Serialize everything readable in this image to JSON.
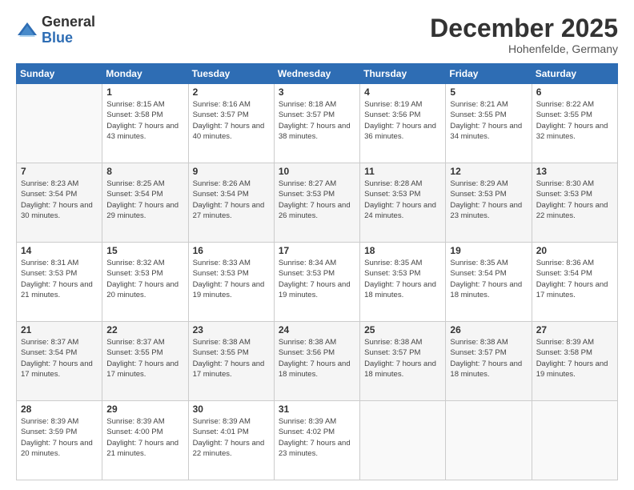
{
  "logo": {
    "general": "General",
    "blue": "Blue"
  },
  "title": "December 2025",
  "location": "Hohenfelde, Germany",
  "days_of_week": [
    "Sunday",
    "Monday",
    "Tuesday",
    "Wednesday",
    "Thursday",
    "Friday",
    "Saturday"
  ],
  "weeks": [
    [
      {
        "day": "",
        "sunrise": "",
        "sunset": "",
        "daylight": ""
      },
      {
        "day": "1",
        "sunrise": "Sunrise: 8:15 AM",
        "sunset": "Sunset: 3:58 PM",
        "daylight": "Daylight: 7 hours and 43 minutes."
      },
      {
        "day": "2",
        "sunrise": "Sunrise: 8:16 AM",
        "sunset": "Sunset: 3:57 PM",
        "daylight": "Daylight: 7 hours and 40 minutes."
      },
      {
        "day": "3",
        "sunrise": "Sunrise: 8:18 AM",
        "sunset": "Sunset: 3:57 PM",
        "daylight": "Daylight: 7 hours and 38 minutes."
      },
      {
        "day": "4",
        "sunrise": "Sunrise: 8:19 AM",
        "sunset": "Sunset: 3:56 PM",
        "daylight": "Daylight: 7 hours and 36 minutes."
      },
      {
        "day": "5",
        "sunrise": "Sunrise: 8:21 AM",
        "sunset": "Sunset: 3:55 PM",
        "daylight": "Daylight: 7 hours and 34 minutes."
      },
      {
        "day": "6",
        "sunrise": "Sunrise: 8:22 AM",
        "sunset": "Sunset: 3:55 PM",
        "daylight": "Daylight: 7 hours and 32 minutes."
      }
    ],
    [
      {
        "day": "7",
        "sunrise": "Sunrise: 8:23 AM",
        "sunset": "Sunset: 3:54 PM",
        "daylight": "Daylight: 7 hours and 30 minutes."
      },
      {
        "day": "8",
        "sunrise": "Sunrise: 8:25 AM",
        "sunset": "Sunset: 3:54 PM",
        "daylight": "Daylight: 7 hours and 29 minutes."
      },
      {
        "day": "9",
        "sunrise": "Sunrise: 8:26 AM",
        "sunset": "Sunset: 3:54 PM",
        "daylight": "Daylight: 7 hours and 27 minutes."
      },
      {
        "day": "10",
        "sunrise": "Sunrise: 8:27 AM",
        "sunset": "Sunset: 3:53 PM",
        "daylight": "Daylight: 7 hours and 26 minutes."
      },
      {
        "day": "11",
        "sunrise": "Sunrise: 8:28 AM",
        "sunset": "Sunset: 3:53 PM",
        "daylight": "Daylight: 7 hours and 24 minutes."
      },
      {
        "day": "12",
        "sunrise": "Sunrise: 8:29 AM",
        "sunset": "Sunset: 3:53 PM",
        "daylight": "Daylight: 7 hours and 23 minutes."
      },
      {
        "day": "13",
        "sunrise": "Sunrise: 8:30 AM",
        "sunset": "Sunset: 3:53 PM",
        "daylight": "Daylight: 7 hours and 22 minutes."
      }
    ],
    [
      {
        "day": "14",
        "sunrise": "Sunrise: 8:31 AM",
        "sunset": "Sunset: 3:53 PM",
        "daylight": "Daylight: 7 hours and 21 minutes."
      },
      {
        "day": "15",
        "sunrise": "Sunrise: 8:32 AM",
        "sunset": "Sunset: 3:53 PM",
        "daylight": "Daylight: 7 hours and 20 minutes."
      },
      {
        "day": "16",
        "sunrise": "Sunrise: 8:33 AM",
        "sunset": "Sunset: 3:53 PM",
        "daylight": "Daylight: 7 hours and 19 minutes."
      },
      {
        "day": "17",
        "sunrise": "Sunrise: 8:34 AM",
        "sunset": "Sunset: 3:53 PM",
        "daylight": "Daylight: 7 hours and 19 minutes."
      },
      {
        "day": "18",
        "sunrise": "Sunrise: 8:35 AM",
        "sunset": "Sunset: 3:53 PM",
        "daylight": "Daylight: 7 hours and 18 minutes."
      },
      {
        "day": "19",
        "sunrise": "Sunrise: 8:35 AM",
        "sunset": "Sunset: 3:54 PM",
        "daylight": "Daylight: 7 hours and 18 minutes."
      },
      {
        "day": "20",
        "sunrise": "Sunrise: 8:36 AM",
        "sunset": "Sunset: 3:54 PM",
        "daylight": "Daylight: 7 hours and 17 minutes."
      }
    ],
    [
      {
        "day": "21",
        "sunrise": "Sunrise: 8:37 AM",
        "sunset": "Sunset: 3:54 PM",
        "daylight": "Daylight: 7 hours and 17 minutes."
      },
      {
        "day": "22",
        "sunrise": "Sunrise: 8:37 AM",
        "sunset": "Sunset: 3:55 PM",
        "daylight": "Daylight: 7 hours and 17 minutes."
      },
      {
        "day": "23",
        "sunrise": "Sunrise: 8:38 AM",
        "sunset": "Sunset: 3:55 PM",
        "daylight": "Daylight: 7 hours and 17 minutes."
      },
      {
        "day": "24",
        "sunrise": "Sunrise: 8:38 AM",
        "sunset": "Sunset: 3:56 PM",
        "daylight": "Daylight: 7 hours and 18 minutes."
      },
      {
        "day": "25",
        "sunrise": "Sunrise: 8:38 AM",
        "sunset": "Sunset: 3:57 PM",
        "daylight": "Daylight: 7 hours and 18 minutes."
      },
      {
        "day": "26",
        "sunrise": "Sunrise: 8:38 AM",
        "sunset": "Sunset: 3:57 PM",
        "daylight": "Daylight: 7 hours and 18 minutes."
      },
      {
        "day": "27",
        "sunrise": "Sunrise: 8:39 AM",
        "sunset": "Sunset: 3:58 PM",
        "daylight": "Daylight: 7 hours and 19 minutes."
      }
    ],
    [
      {
        "day": "28",
        "sunrise": "Sunrise: 8:39 AM",
        "sunset": "Sunset: 3:59 PM",
        "daylight": "Daylight: 7 hours and 20 minutes."
      },
      {
        "day": "29",
        "sunrise": "Sunrise: 8:39 AM",
        "sunset": "Sunset: 4:00 PM",
        "daylight": "Daylight: 7 hours and 21 minutes."
      },
      {
        "day": "30",
        "sunrise": "Sunrise: 8:39 AM",
        "sunset": "Sunset: 4:01 PM",
        "daylight": "Daylight: 7 hours and 22 minutes."
      },
      {
        "day": "31",
        "sunrise": "Sunrise: 8:39 AM",
        "sunset": "Sunset: 4:02 PM",
        "daylight": "Daylight: 7 hours and 23 minutes."
      },
      {
        "day": "",
        "sunrise": "",
        "sunset": "",
        "daylight": ""
      },
      {
        "day": "",
        "sunrise": "",
        "sunset": "",
        "daylight": ""
      },
      {
        "day": "",
        "sunrise": "",
        "sunset": "",
        "daylight": ""
      }
    ]
  ]
}
